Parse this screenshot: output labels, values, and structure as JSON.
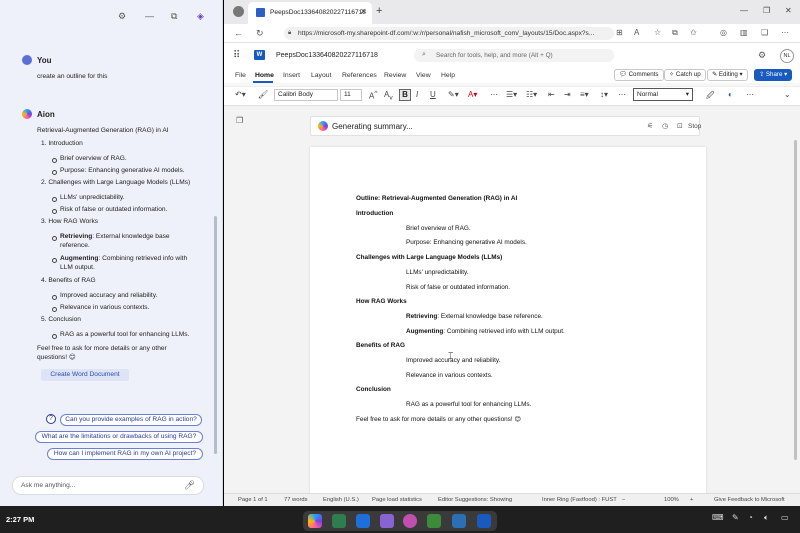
{
  "sidebar": {
    "user_name": "You",
    "user_message": "create an outline for this",
    "bot_name": "Aion",
    "reply_title": "Retrieval-Augmented Generation (RAG) in AI",
    "sections": [
      {
        "heading": "1. Introduction",
        "items": [
          "Brief overview of RAG.",
          "Purpose: Enhancing generative AI models."
        ]
      },
      {
        "heading": "2. Challenges with Large Language Models (LLMs)",
        "items": [
          "LLMs' unpredictability.",
          "Risk of false or outdated information."
        ]
      },
      {
        "heading": "3. How RAG Works",
        "items": [
          {
            "bold": "Retrieving",
            "rest": ": External knowledge base",
            "cont": "reference."
          },
          {
            "bold": "Augmenting",
            "rest": ": Combining retrieved info with",
            "cont": "LLM output."
          }
        ]
      },
      {
        "heading": "4. Benefits of RAG",
        "items": [
          "Improved accuracy and reliability.",
          "Relevance in various contexts."
        ]
      },
      {
        "heading": "5. Conclusion",
        "items": [
          "RAG as a powerful tool for enhancing LLMs."
        ]
      }
    ],
    "closing_1": "Feel free to ask for more details or any other",
    "closing_2": "questions! 😊",
    "create_button": "Create Word Document",
    "suggestions": [
      "Can you provide examples of RAG in action?",
      "What are the limitations or drawbacks of using RAG?",
      "How can I implement RAG in my own AI project?"
    ],
    "ask_placeholder": "Ask me anything..."
  },
  "browser": {
    "tab_title": "PeepsDoc133640820227116718",
    "url": "https://microsoft-my.sharepoint-df.com/:w:/r/personal/nafish_microsoft_com/_layouts/15/Doc.aspx?s..."
  },
  "word": {
    "doc_title": "PeepsDoc133640820227116718",
    "search_placeholder": "Search for tools, help, and more (Alt + Q)",
    "avatar_initials": "NL",
    "menu": [
      "File",
      "Home",
      "Insert",
      "Layout",
      "References",
      "Review",
      "View",
      "Help"
    ],
    "comments": "Comments",
    "catchup": "Catch up",
    "editing": "Editing",
    "share": "Share",
    "font": "Calibri Body",
    "size": "11",
    "style": "Normal",
    "generating": "Generating summary...",
    "stop": "Stop"
  },
  "document": {
    "title": "Outline: Retrieval-Augmented Generation (RAG) in AI",
    "lines": [
      {
        "type": "h",
        "text": "Introduction"
      },
      {
        "type": "i",
        "text": "Brief overview of RAG."
      },
      {
        "type": "i",
        "text": "Purpose: Enhancing generative AI models."
      },
      {
        "type": "h",
        "text": "Challenges with Large Language Models (LLMs)"
      },
      {
        "type": "i",
        "text": "LLMs' unpredictability."
      },
      {
        "type": "i",
        "text": "Risk of false or outdated information."
      },
      {
        "type": "h",
        "text": "How RAG Works"
      },
      {
        "type": "b",
        "bold": "Retrieving",
        "text": ": External knowledge base reference."
      },
      {
        "type": "b",
        "bold": "Augmenting",
        "text": ": Combining retrieved info with LLM output."
      },
      {
        "type": "h",
        "text": "Benefits of RAG"
      },
      {
        "type": "i",
        "text": "Improved accuracy and reliability."
      },
      {
        "type": "i",
        "text": "Relevance in various contexts."
      },
      {
        "type": "h",
        "text": "Conclusion"
      },
      {
        "type": "i",
        "text": "RAG as a powerful tool for enhancing LLMs."
      },
      {
        "type": "p",
        "text": "Feel free to ask for more details or any other questions! 😊"
      }
    ]
  },
  "status": {
    "page": "Page 1 of 1",
    "words": "77 words",
    "language": "English (U.S.)",
    "page_load": "Page load statistics",
    "editor": "Editor Suggestions: Showing",
    "ring": "Inner Ring (Fastfood) : FUST",
    "zoom": "100%",
    "feedback": "Give Feedback to Microsoft"
  },
  "taskbar": {
    "time": "2:27 PM"
  }
}
